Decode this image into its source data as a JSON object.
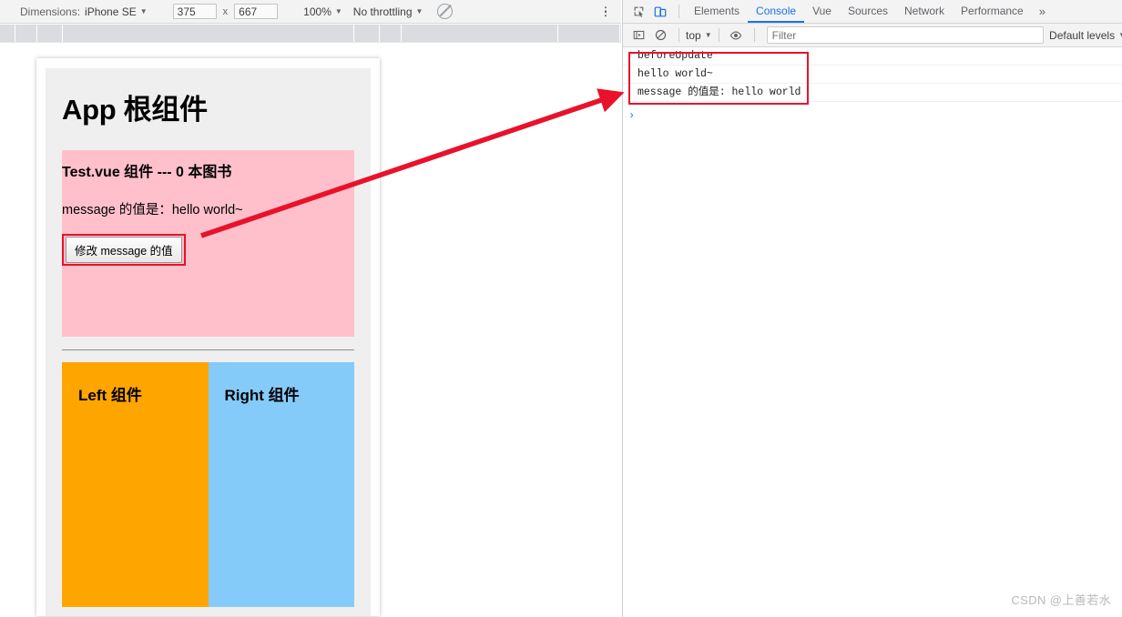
{
  "device_toolbar": {
    "dimensions_label": "Dimensions:",
    "device_name": "iPhone SE",
    "width_value": "375",
    "height_value": "667",
    "times_symbol": "x",
    "zoom_value": "100%",
    "throttling_value": "No throttling",
    "throttle_icon": "no-throttle-icon",
    "menu_icon": "kebab-menu-icon",
    "caret": "▼"
  },
  "app": {
    "title": "App 根组件",
    "test_component": {
      "title": "Test.vue 组件 --- 0 本图书",
      "message_line": "message 的值是：hello world~",
      "button_label": "修改 message 的值"
    },
    "left_component": {
      "title": "Left 组件"
    },
    "right_component": {
      "title": "Right 组件"
    }
  },
  "devtools": {
    "inspect_icon": "inspect-element-icon",
    "device_toolbar_icon": "toggle-device-toolbar-icon",
    "tabs": [
      {
        "label": "Elements",
        "active": false
      },
      {
        "label": "Console",
        "active": true
      },
      {
        "label": "Vue",
        "active": false
      },
      {
        "label": "Sources",
        "active": false
      },
      {
        "label": "Network",
        "active": false
      },
      {
        "label": "Performance",
        "active": false
      }
    ],
    "more_tabs": "»",
    "console_toolbar": {
      "sidebar_icon": "console-sidebar-icon",
      "clear_icon": "clear-console-icon",
      "context_value": "top",
      "eye_icon": "live-expression-eye-icon",
      "filter_placeholder": "Filter",
      "filter_value": "",
      "levels_value": "Default levels",
      "caret": "▼"
    },
    "console_logs": [
      "beforeUpdate",
      "hello world~",
      "message 的值是: hello world"
    ],
    "prompt_symbol": "›"
  },
  "annotations": {
    "arrow_color": "#e8122a",
    "box_color": "#e8122a"
  },
  "watermark": "CSDN @上善若水",
  "colors": {
    "pink_panel": "#ffc0cb",
    "orange_panel": "#ffa500",
    "blue_panel": "#85cbfa",
    "app_background": "#efefef",
    "accent_blue": "#1a73e8"
  }
}
